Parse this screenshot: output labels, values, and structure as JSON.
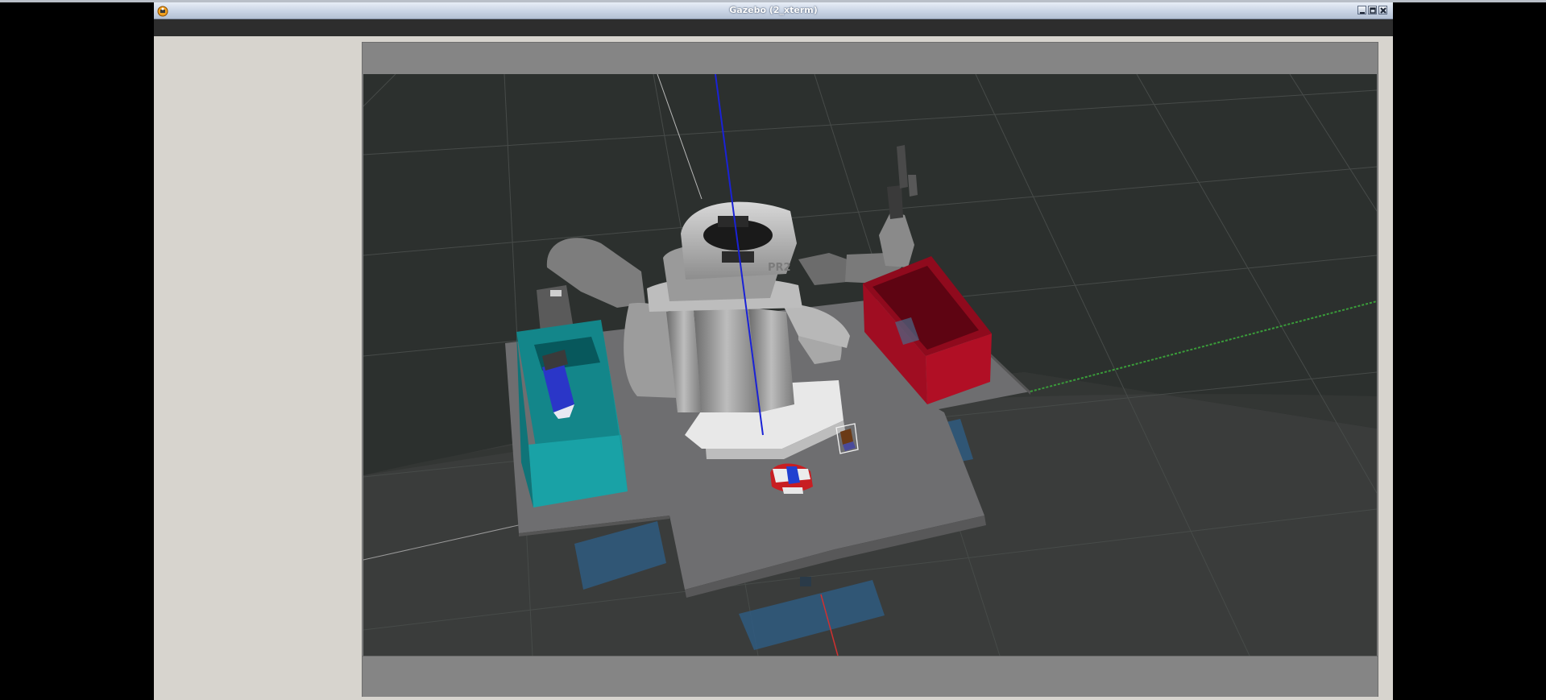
{
  "window": {
    "title": "Gazebo (2_xterm)",
    "icons": {
      "app": "gazebo-app-icon",
      "minimize": "minimize-icon",
      "maximize": "maximize-icon",
      "close": "close-icon"
    }
  },
  "scene": {
    "robot_label": "PR2",
    "objects": [
      "pr2-robot",
      "green-drop-box",
      "red-drop-box",
      "table",
      "biscuits-box",
      "soap-box",
      "grasped-object"
    ],
    "colors": {
      "background": "#2c302e",
      "green_box": "#19a2a6",
      "red_box": "#a80d22",
      "table": "#6e6e70",
      "axis_z": "#1a22d6",
      "axis_y": "#3a9c3a",
      "axis_x": "#d03030"
    }
  }
}
